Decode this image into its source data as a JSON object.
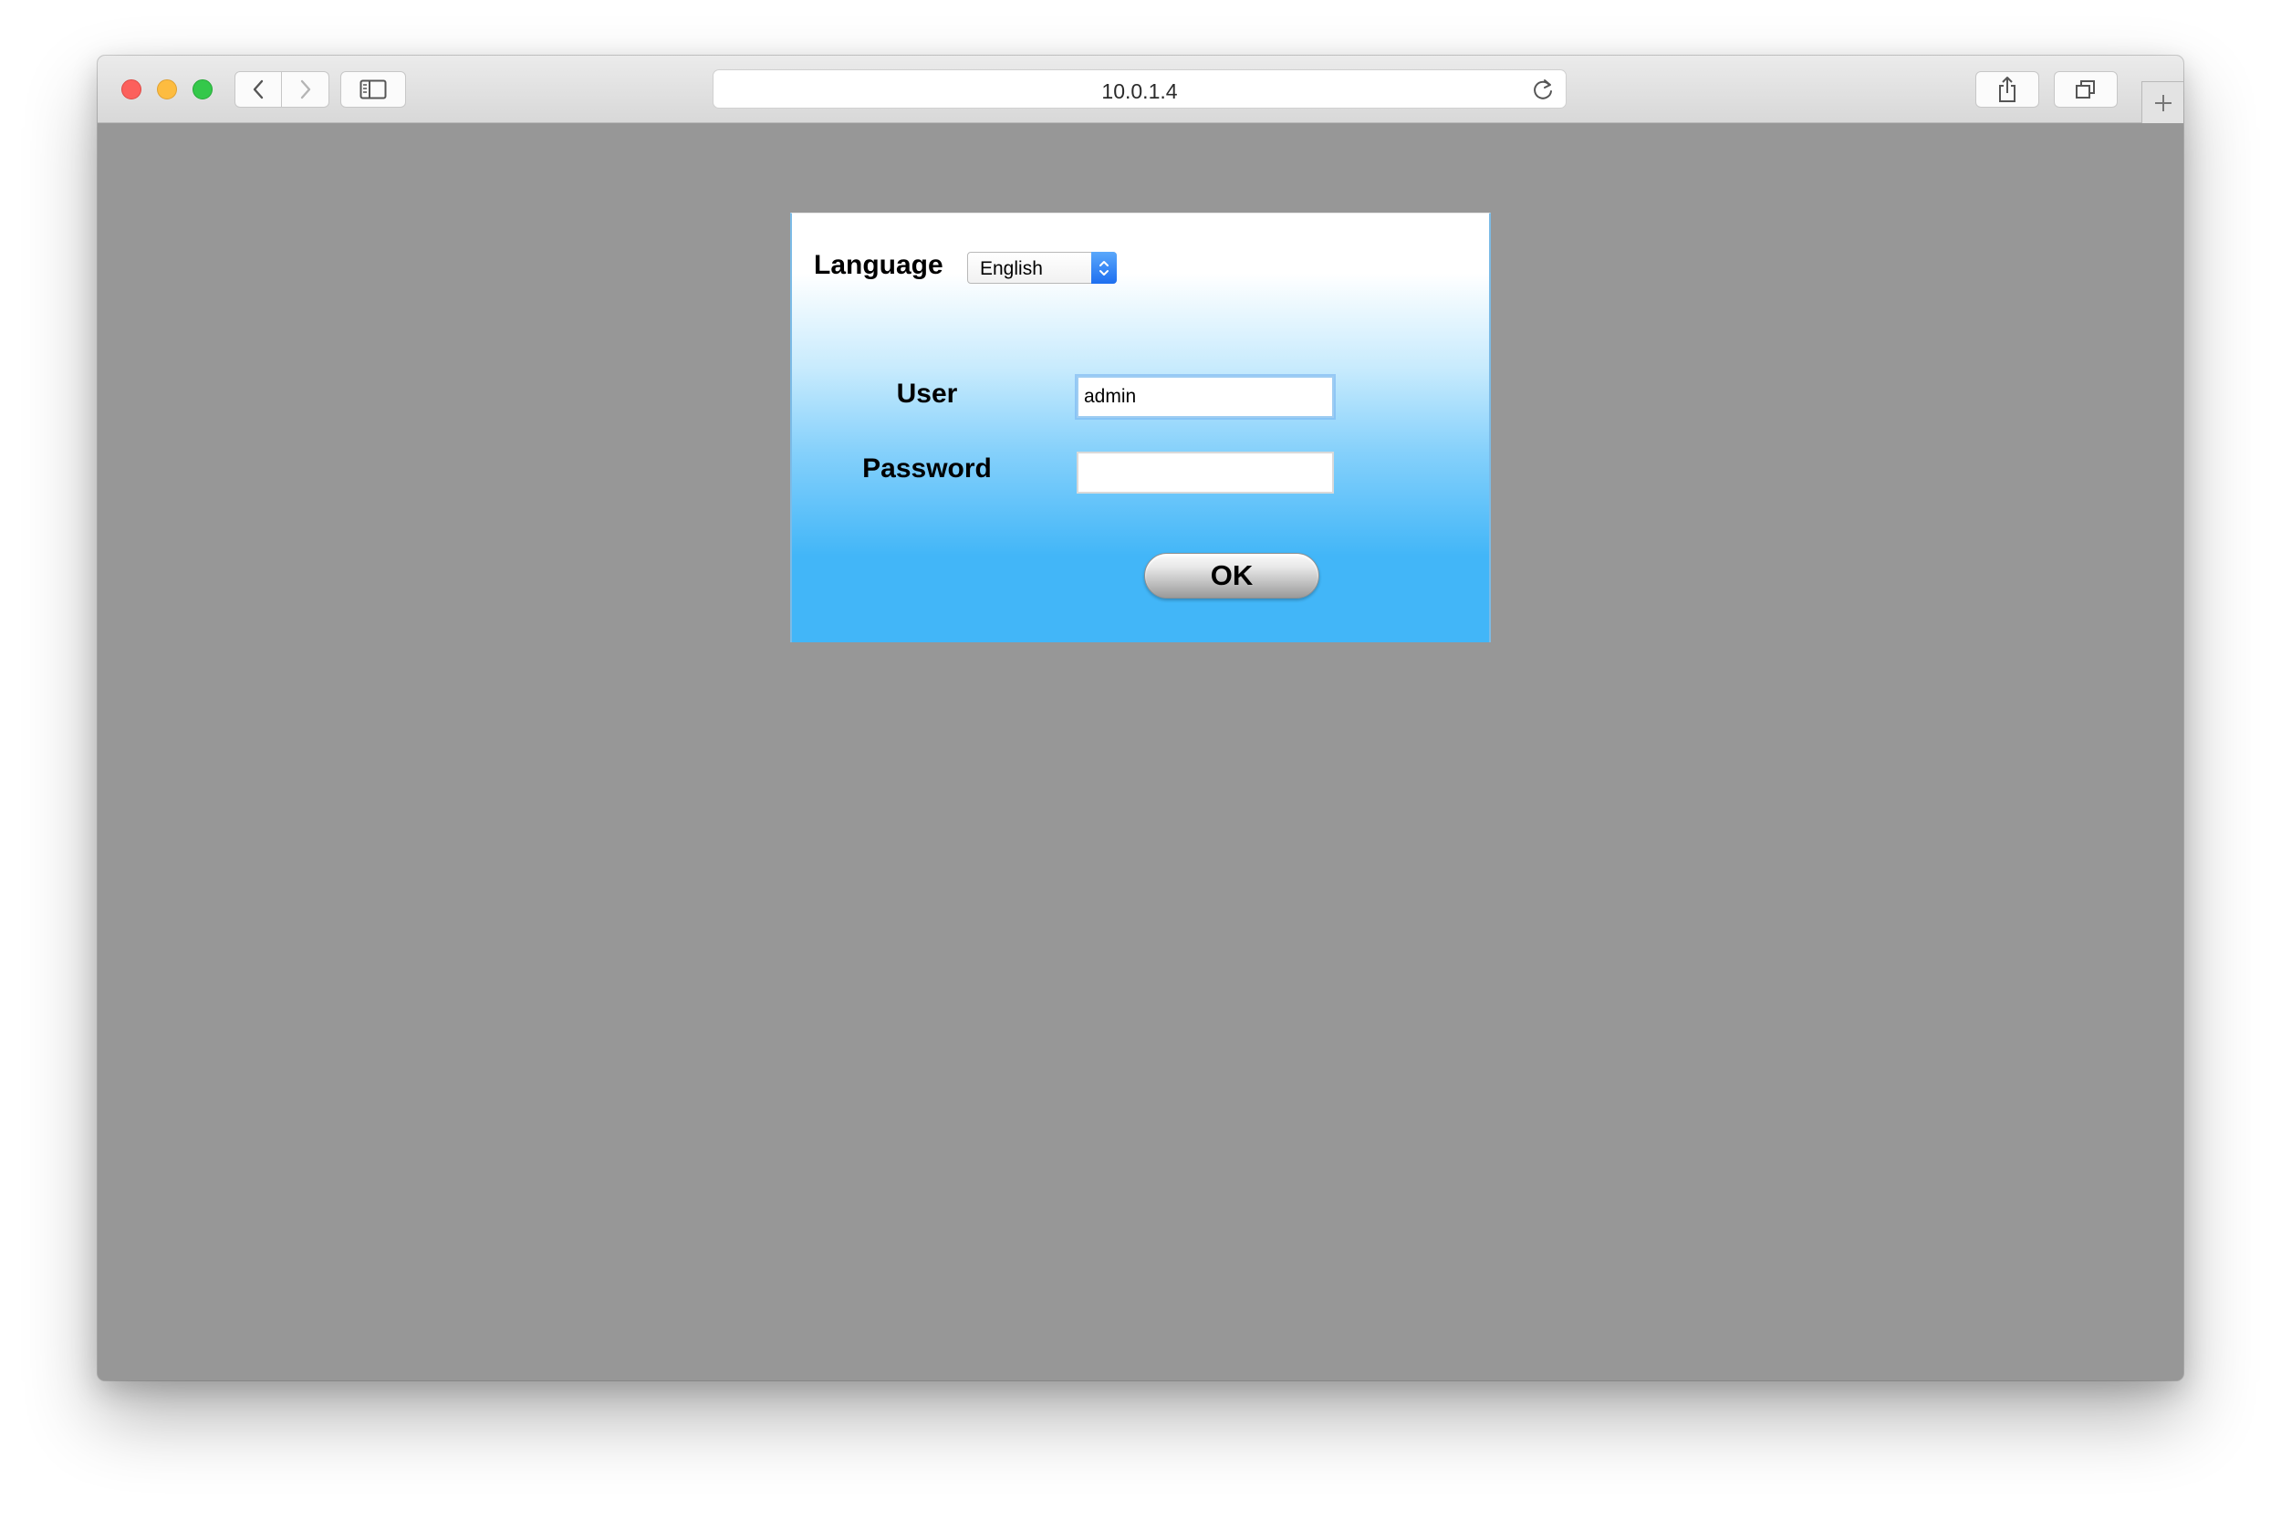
{
  "browser": {
    "url": "10.0.1.4",
    "icons": {
      "back": "chevron-left-icon",
      "forward": "chevron-right-icon",
      "sidebar": "sidebar-icon",
      "reload": "reload-icon",
      "share": "share-icon",
      "tabs": "tabs-overview-icon",
      "new_tab": "plus-icon"
    }
  },
  "login": {
    "language_label": "Language",
    "language_selected": "English",
    "user_label": "User",
    "user_value": "admin",
    "password_label": "Password",
    "password_value": "",
    "ok_label": "OK"
  },
  "colors": {
    "page_background": "#979797",
    "panel_gradient_top": "#ffffff",
    "panel_gradient_bottom": "#42b6f8",
    "select_accent": "#1e6ff0"
  }
}
